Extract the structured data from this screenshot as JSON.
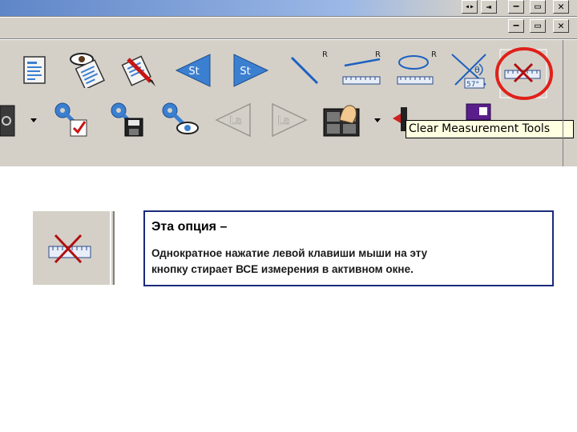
{
  "window_controls": {
    "row1": [
      "−",
      "▭",
      "✕"
    ],
    "row2": [
      "−",
      "▭",
      "✕"
    ]
  },
  "toolbar": {
    "row1": [
      {
        "icon": "report-icon"
      },
      {
        "icon": "eye-document-icon"
      },
      {
        "icon": "pen-edit-icon"
      },
      {
        "icon": "arrow-left-st-icon",
        "label": "St"
      },
      {
        "icon": "arrow-right-st-icon",
        "label": "St"
      },
      {
        "icon": "line-measure-icon",
        "badge": "R"
      },
      {
        "icon": "horizontal-line-measure-icon",
        "badge": "R"
      },
      {
        "icon": "ellipse-measure-icon",
        "badge": "R"
      },
      {
        "icon": "angle-measure-icon",
        "angle_text": "57°",
        "theta": "θ"
      },
      {
        "icon": "clear-measurement-icon",
        "highlighted": true
      }
    ],
    "row2": [
      {
        "icon": "gear-icon"
      },
      {
        "icon": "key-check-icon"
      },
      {
        "icon": "key-save-icon"
      },
      {
        "icon": "key-eye-icon"
      },
      {
        "icon": "arrow-left-la-icon",
        "label": "La",
        "disabled": true
      },
      {
        "icon": "arrow-right-la-icon",
        "label": "La",
        "disabled": true
      },
      {
        "icon": "hand-grid-icon"
      },
      {
        "icon": "red-arrow-icon"
      },
      {
        "icon": "purple-tool-icon"
      }
    ]
  },
  "tooltip": "Clear Measurement Tools",
  "colors": {
    "toolbar_bg": "#d4d0c8",
    "highlight_circle": "#e0201a",
    "icon_blue": "#3b7fd0",
    "panel_border": "#1a2a7a",
    "x_red": "#b01010"
  },
  "panel": {
    "title": "Эта опция –",
    "body_line1": "Однократное нажатие левой клавиши мыши на эту",
    "body_line2": "кнопку  стирает ВСЕ измерения в активном окне."
  }
}
